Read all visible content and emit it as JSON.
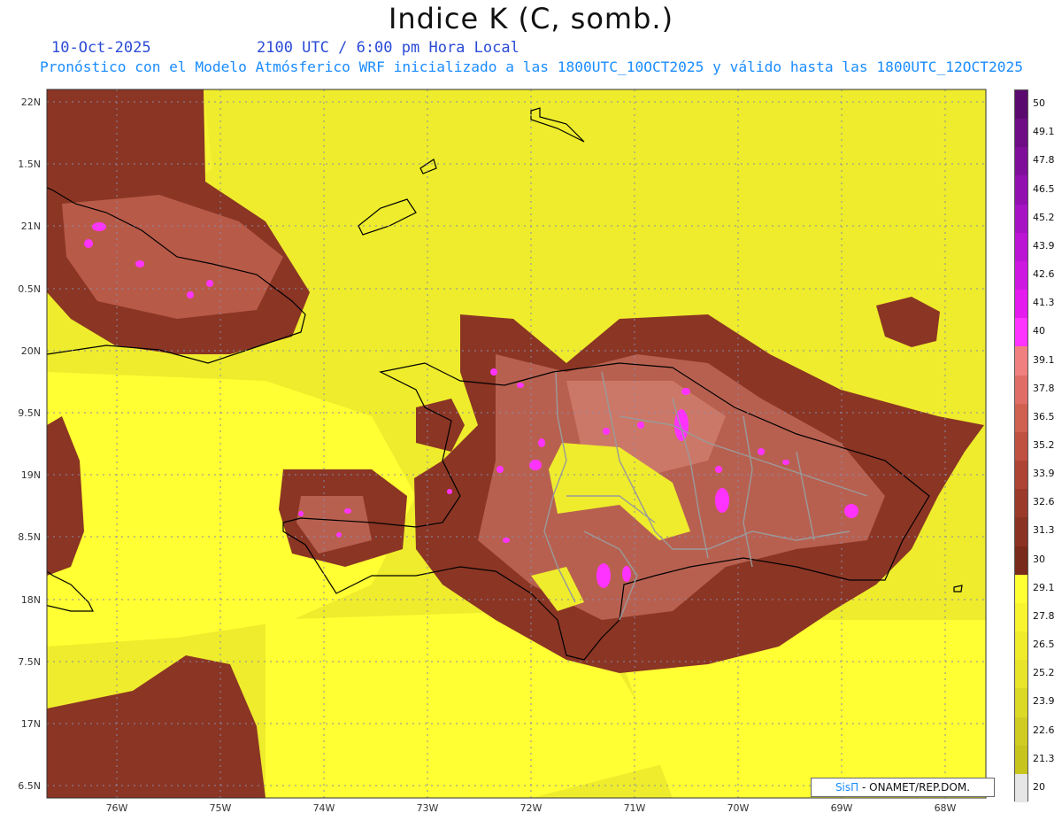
{
  "title": "Indice K (C, somb.)",
  "date": "10-Oct-2025",
  "valid_time": "2100 UTC / 6:00 pm Hora Local",
  "model_info": "Pronóstico con el Modelo Atmósferico WRF inicializado a las 1800UTC_10OCT2025 y válido hasta las  1800UTC_12OCT2025",
  "lat_labels": [
    "22N",
    "1.5N",
    "21N",
    "0.5N",
    "20N",
    "9.5N",
    "19N",
    "8.5N",
    "18N",
    "7.5N",
    "17N",
    "6.5N"
  ],
  "lon_labels": [
    "76W",
    "75W",
    "74W",
    "73W",
    "72W",
    "71W",
    "70W",
    "69W",
    "68W"
  ],
  "colorbar": {
    "labels": [
      "50",
      "49.1",
      "47.8",
      "46.5",
      "45.2",
      "43.9",
      "42.6",
      "41.3",
      "40",
      "39.1",
      "37.8",
      "36.5",
      "35.2",
      "33.9",
      "32.6",
      "31.3",
      "30",
      "29.1",
      "27.8",
      "26.5",
      "25.2",
      "23.9",
      "22.6",
      "21.3",
      "20"
    ],
    "colors": [
      "#5a0a6e",
      "#6e0d85",
      "#7f0f9a",
      "#920fb0",
      "#a612c4",
      "#bb14d4",
      "#cf17e2",
      "#e41aee",
      "#ff33ff",
      "#f08080",
      "#e06e66",
      "#d06050",
      "#c05040",
      "#ae4434",
      "#9c3a2a",
      "#8b3222",
      "#7a2a1a",
      "#ffff33",
      "#f8f430",
      "#f0ec2c",
      "#e8e42a",
      "#dcd826",
      "#d0cc22",
      "#c8c41e",
      "#e6e6e6"
    ]
  },
  "colors": {
    "low_k": "#eeee2a",
    "very_low_k": "#ffff33",
    "moderate_k": "#8b3524",
    "high_k": "#c86a5a",
    "very_high_k": "#ff33ff",
    "coast": "#000000",
    "provinces": "#9a9a9a"
  },
  "credit": {
    "brand": "SisΠ",
    "text": "- ONAMET/REP.DOM."
  }
}
